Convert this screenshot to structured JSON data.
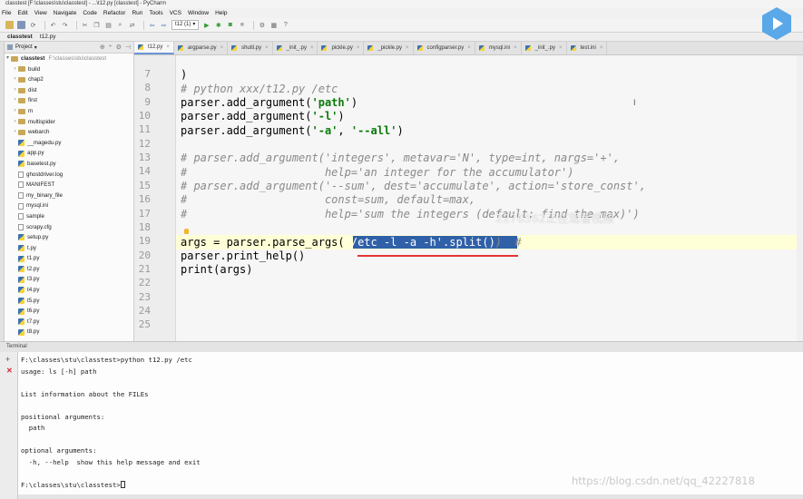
{
  "window": {
    "title": "classtest [F:\\classes\\stu\\classtest] - ...\\t12.py [classtest] - PyCharm"
  },
  "menu": [
    "File",
    "Edit",
    "View",
    "Navigate",
    "Code",
    "Refactor",
    "Run",
    "Tools",
    "VCS",
    "Window",
    "Help"
  ],
  "toolbar": {
    "run_config": "t12 (1)"
  },
  "breadcrumbs": [
    "classtest",
    "t12.py"
  ],
  "project": {
    "header": "Project",
    "root_name": "classtest",
    "root_path": "F:\\classes\\stu\\classtest",
    "folders": [
      "build",
      "chap2",
      "dist",
      "first",
      "m",
      "multispider",
      "webarch"
    ],
    "files": [
      "__magedu.py",
      "app.py",
      "basetest.py",
      "ghostdriver.log",
      "MANIFEST",
      "my_binary_file",
      "mysql.ini",
      "sample",
      "scrapy.cfg",
      "setup.py",
      "t.py",
      "t1.py",
      "t2.py",
      "t3.py",
      "t4.py",
      "t5.py",
      "t6.py",
      "t7.py",
      "t8.py"
    ]
  },
  "tabs": [
    "t12.py",
    "argparse.py",
    "shutil.py",
    "_init_.py",
    "pickle.py",
    "_pickle.py",
    "configparser.py",
    "mysql.ini",
    "_init_.py",
    "test.ini"
  ],
  "editor": {
    "line_numbers": [
      "7",
      "8",
      "9",
      "10",
      "11",
      "12",
      "13",
      "14",
      "15",
      "16",
      "17",
      "18",
      "19",
      "20",
      "21",
      "22",
      "23",
      "24",
      "25"
    ],
    "line7": ")",
    "line8": "# python xxx/t12.py /etc",
    "line9_a": "parser.add_argument(",
    "line9_s": "'path'",
    "line9_b": ")",
    "line10_a": "parser.add_argument(",
    "line10_s": "'-l'",
    "line10_b": ")",
    "line11_a": "parser.add_argument(",
    "line11_s1": "'-a'",
    "line11_m": ", ",
    "line11_s2": "'--all'",
    "line11_b": ")",
    "line13": "# parser.add_argument('integers', metavar='N', type=int, nargs='+',",
    "line14": "#                     help='an integer for the accumulator')",
    "line15": "# parser.add_argument('--sum', dest='accumulate', action='store_const',",
    "line16": "#                     const=sum, default=max,",
    "line17": "#                     help='sum the integers (default: find the max)')",
    "line19_a": "args = parser.parse_args(",
    "line19_sel": "'/etc -l -a -h'.split()",
    "line19_b": ")  #",
    "line20": "parser.print_help()",
    "line21": "print(args)"
  },
  "overlay_text": "2276562正在观看视频",
  "terminal": {
    "header": "Terminal",
    "lines": [
      "F:\\classes\\stu\\classtest>python t12.py /etc",
      "usage: ls [-h] path",
      "",
      "List information about the FILEs",
      "",
      "positional arguments:",
      "  path",
      "",
      "optional arguments:",
      "  -h, --help  show this help message and exit",
      ""
    ],
    "prompt": "F:\\classes\\stu\\classtest>"
  },
  "watermark": "https://blog.csdn.net/qq_42227818"
}
